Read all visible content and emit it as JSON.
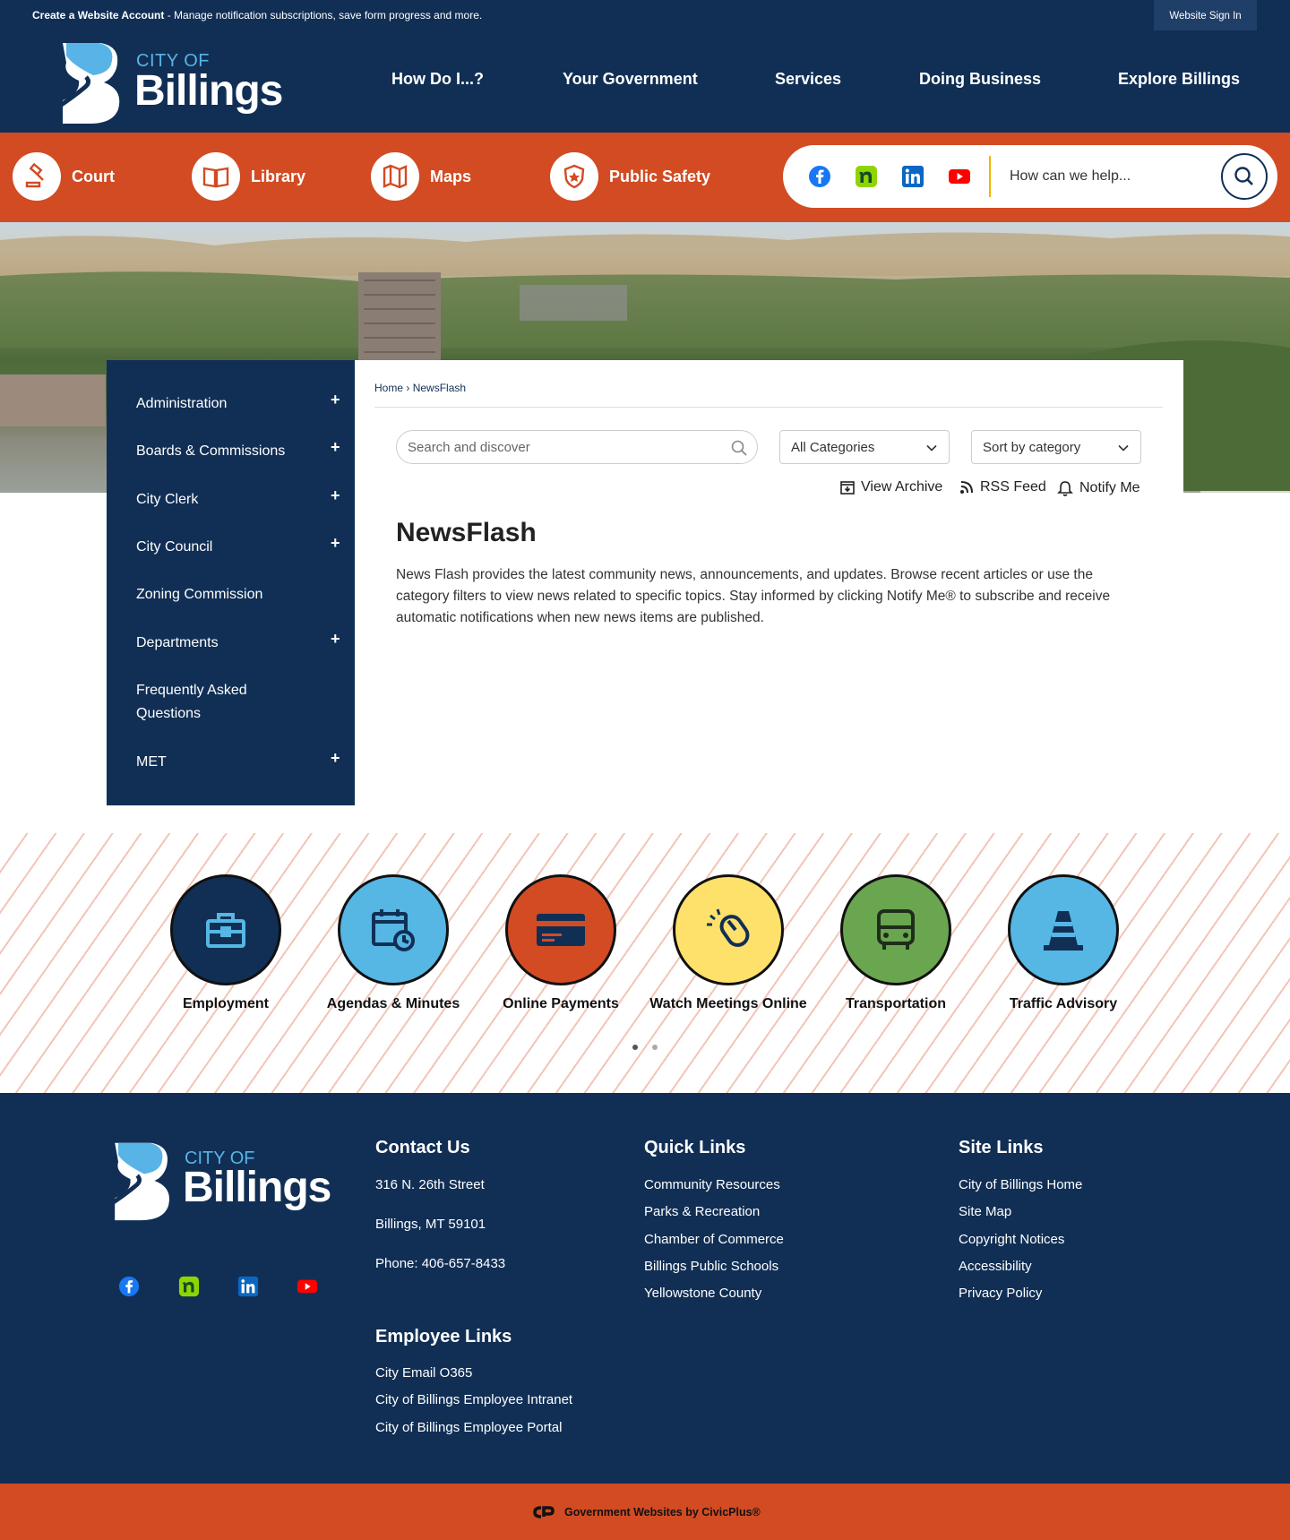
{
  "topbar": {
    "account_bold": "Create a Website Account",
    "account_text": " - Manage notification subscriptions, save form progress and more.",
    "signin": "Website Sign In"
  },
  "logo": {
    "city_of": "CITY OF",
    "name": "Billings"
  },
  "nav": [
    "How Do I...?",
    "Your Government",
    "Services",
    "Doing Business",
    "Explore Billings"
  ],
  "quick_links": [
    "Court",
    "Library",
    "Maps",
    "Public Safety"
  ],
  "social": [
    "facebook-icon",
    "nextdoor-icon",
    "linkedin-icon",
    "youtube-icon"
  ],
  "search": {
    "placeholder": "How can we help..."
  },
  "sidebar": {
    "items": [
      "Administration",
      "Boards & Commissions",
      "City Clerk",
      "City Council",
      "Zoning Commission",
      "Departments",
      "Frequently Asked Questions",
      "MET"
    ],
    "plus": "+"
  },
  "breadcrumb": {
    "home": "Home",
    "sep": "›",
    "current": "NewsFlash"
  },
  "filters": {
    "search_placeholder": "Search and discover",
    "category": "All Categories",
    "sort": "Sort by category"
  },
  "tools": {
    "archive": "View Archive",
    "rss": "RSS Feed",
    "notify": "Notify Me"
  },
  "content": {
    "title": "NewsFlash",
    "description": "News Flash provides the latest community news, announcements, and updates. Browse recent articles or use the category filters to view news related to specific topics. Stay informed by clicking Notify Me® to subscribe and receive automatic notifications when new news items are published."
  },
  "features": [
    {
      "label": "Employment",
      "color": "#112f55"
    },
    {
      "label": "Agendas & Minutes",
      "color": "#56b6e4"
    },
    {
      "label": "Online Payments",
      "color": "#d24b23"
    },
    {
      "label": "Watch Meetings Online",
      "color": "#fde16b"
    },
    {
      "label": "Transportation",
      "color": "#6aa54f"
    },
    {
      "label": "Traffic Advisory",
      "color": "#56b6e4"
    }
  ],
  "footer": {
    "contact": {
      "heading": "Contact Us",
      "address1": "316 N. 26th Street",
      "address2": "Billings, MT 59101",
      "phone": "Phone: 406-657-8433"
    },
    "employee": {
      "heading": "Employee Links",
      "links": [
        "City Email O365",
        "City of Billings Employee Intranet",
        "City of Billings Employee Portal"
      ]
    },
    "quick": {
      "heading": "Quick Links",
      "links": [
        "Community Resources",
        "Parks & Recreation",
        "Chamber of Commerce",
        "Billings Public Schools",
        "Yellowstone County"
      ]
    },
    "site": {
      "heading": "Site Links",
      "links": [
        "City of Billings Home",
        "Site Map",
        "Copyright Notices",
        "Accessibility",
        "Privacy Policy"
      ]
    },
    "civicplus": "Government Websites by CivicPlus®"
  }
}
